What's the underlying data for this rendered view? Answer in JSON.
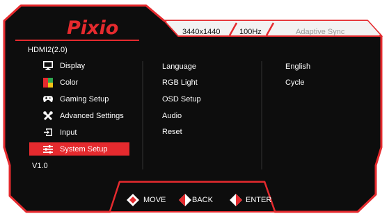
{
  "osd": {
    "brand": "Pixio",
    "top_bar": {
      "resolution": "3440x1440",
      "refresh_rate": "100Hz",
      "adaptive_sync": "Adaptive Sync"
    },
    "input_source": "HDMI2(2.0)",
    "version": "V1.0",
    "menu": [
      {
        "label": "Display",
        "icon": "monitor-icon",
        "active": false
      },
      {
        "label": "Color",
        "icon": "color-icon",
        "active": false
      },
      {
        "label": "Gaming Setup",
        "icon": "gamepad-icon",
        "active": false
      },
      {
        "label": "Advanced Settings",
        "icon": "tools-icon",
        "active": false
      },
      {
        "label": "Input",
        "icon": "input-icon",
        "active": false
      },
      {
        "label": "System Setup",
        "icon": "sliders-icon",
        "active": true
      }
    ],
    "submenu": [
      "Language",
      "RGB Light",
      "OSD Setup",
      "Audio",
      "Reset"
    ],
    "values": [
      "English",
      "Cycle"
    ],
    "hints": [
      {
        "label": "MOVE",
        "icon": "joystick-move-icon"
      },
      {
        "label": "BACK",
        "icon": "joystick-back-icon"
      },
      {
        "label": "ENTER",
        "icon": "joystick-enter-icon"
      }
    ]
  },
  "colors": {
    "accent_red": "#e52a2e",
    "panel_black": "#0d0d0d",
    "top_bar_white": "#f2f2f2",
    "text_white": "#ffffff"
  }
}
